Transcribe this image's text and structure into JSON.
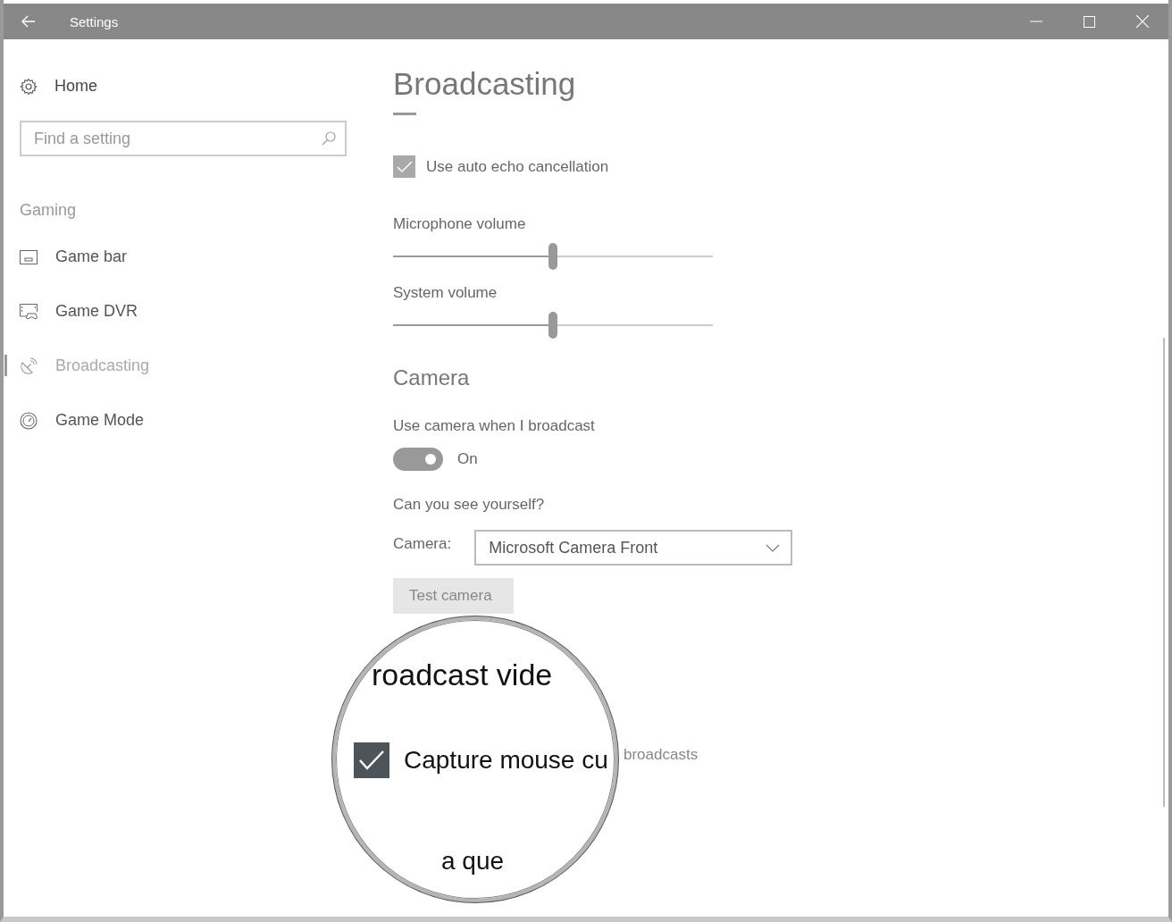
{
  "window": {
    "title": "Settings"
  },
  "sidebar": {
    "home": "Home",
    "search": {
      "placeholder": "Find a setting"
    },
    "section": "Gaming",
    "items": [
      {
        "label": "Game bar",
        "kind": "gamebar",
        "selected": false
      },
      {
        "label": "Game DVR",
        "kind": "dvr",
        "selected": false
      },
      {
        "label": "Broadcasting",
        "kind": "broadcast",
        "selected": true
      },
      {
        "label": "Game Mode",
        "kind": "gamemode",
        "selected": false
      }
    ]
  },
  "page": {
    "title": "Broadcasting",
    "echo": {
      "label": "Use auto echo cancellation",
      "checked": true
    },
    "sliders": [
      {
        "label": "Microphone volume",
        "level": 0.5
      },
      {
        "label": "System volume",
        "level": 0.5
      }
    ],
    "camera": {
      "heading": "Camera",
      "toggle_label": "Use camera when I broadcast",
      "toggle": {
        "on": true,
        "text": "On"
      },
      "question": "Can you see yourself?",
      "camera_label": "Camera:",
      "camera_value": "Microsoft Camera Front",
      "test_button": "Test camera"
    },
    "trailing_text": "broadcasts"
  },
  "magnifier": {
    "heading": "roadcast vide",
    "checkbox": {
      "label": "Capture mouse cu",
      "checked": true
    },
    "partial": "a que"
  }
}
